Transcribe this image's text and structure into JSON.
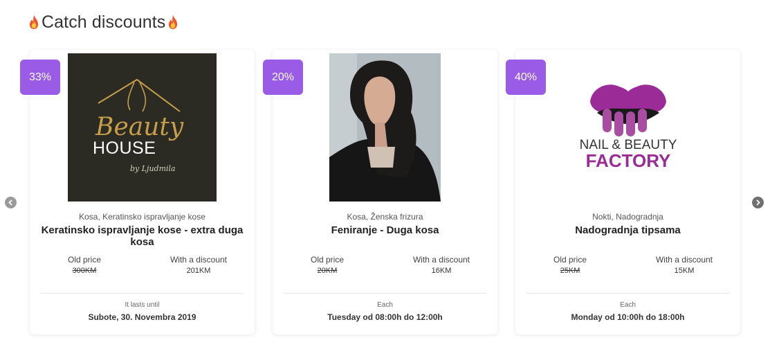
{
  "section": {
    "title": "Catch discounts"
  },
  "icons": {
    "title": "fire-icon",
    "prev": "chevron-left-icon",
    "next": "chevron-right-icon"
  },
  "colors": {
    "badge": "#9a5ce6",
    "logo_bg": "#2b2a23",
    "gold": "#c79f4a",
    "factory_purple": "#9b2b96"
  },
  "cards": [
    {
      "discount": "33%",
      "image": {
        "script": "Beauty",
        "house": "HOUSE",
        "signature": "by Ljudmila"
      },
      "category": "Kosa, Keratinsko ispravljanje kose",
      "name": "Keratinsko ispravljanje kose - extra duga kosa",
      "old_price_label": "Old price",
      "old_price": "300KM",
      "new_price_label": "With a discount",
      "new_price": "201KM",
      "when_label": "It lasts until",
      "when_value": "Subote, 30. Novembra 2019"
    },
    {
      "discount": "20%",
      "category": "Kosa, Ženska frizura",
      "name": "Feniranje - Duga kosa",
      "old_price_label": "Old price",
      "old_price": "20KM",
      "new_price_label": "With a discount",
      "new_price": "16KM",
      "when_label": "Each",
      "when_value": "Tuesday od 08:00h do 12:00h"
    },
    {
      "discount": "40%",
      "image": {
        "line1": "NAIL & BEAUTY",
        "line2": "FACTORY"
      },
      "category": "Nokti, Nadogradnja",
      "name": "Nadogradnja tipsama",
      "old_price_label": "Old price",
      "old_price": "25KM",
      "new_price_label": "With a discount",
      "new_price": "15KM",
      "when_label": "Each",
      "when_value": "Monday od 10:00h do 18:00h"
    }
  ]
}
